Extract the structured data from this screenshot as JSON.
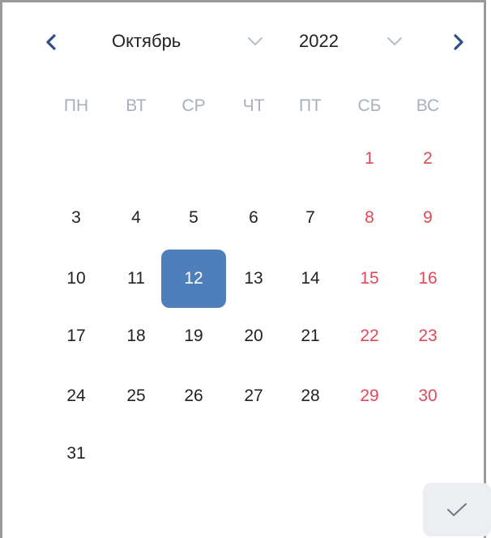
{
  "header": {
    "month": "Октябрь",
    "year": "2022"
  },
  "weekdays": [
    "ПН",
    "ВТ",
    "СР",
    "ЧТ",
    "ПТ",
    "СБ",
    "ВС"
  ],
  "weeks": [
    [
      "",
      "",
      "",
      "",
      "",
      "1",
      "2"
    ],
    [
      "3",
      "4",
      "5",
      "6",
      "7",
      "8",
      "9"
    ],
    [
      "10",
      "11",
      "12",
      "13",
      "14",
      "15",
      "16"
    ],
    [
      "17",
      "18",
      "19",
      "20",
      "21",
      "22",
      "23"
    ],
    [
      "24",
      "25",
      "26",
      "27",
      "28",
      "29",
      "30"
    ],
    [
      "31",
      "",
      "",
      "",
      "",
      "",
      ""
    ]
  ],
  "selected_day": "12",
  "icons": {
    "prev": "chevron-left-icon",
    "next": "chevron-right-icon",
    "month_dropdown": "chevron-down-icon",
    "year_dropdown": "chevron-down-icon",
    "confirm": "check-icon"
  },
  "colors": {
    "accent": "#4e7fbb",
    "weekend": "#e0485a",
    "weekday_header": "#a8b0bc",
    "nav": "#2b4f86"
  }
}
